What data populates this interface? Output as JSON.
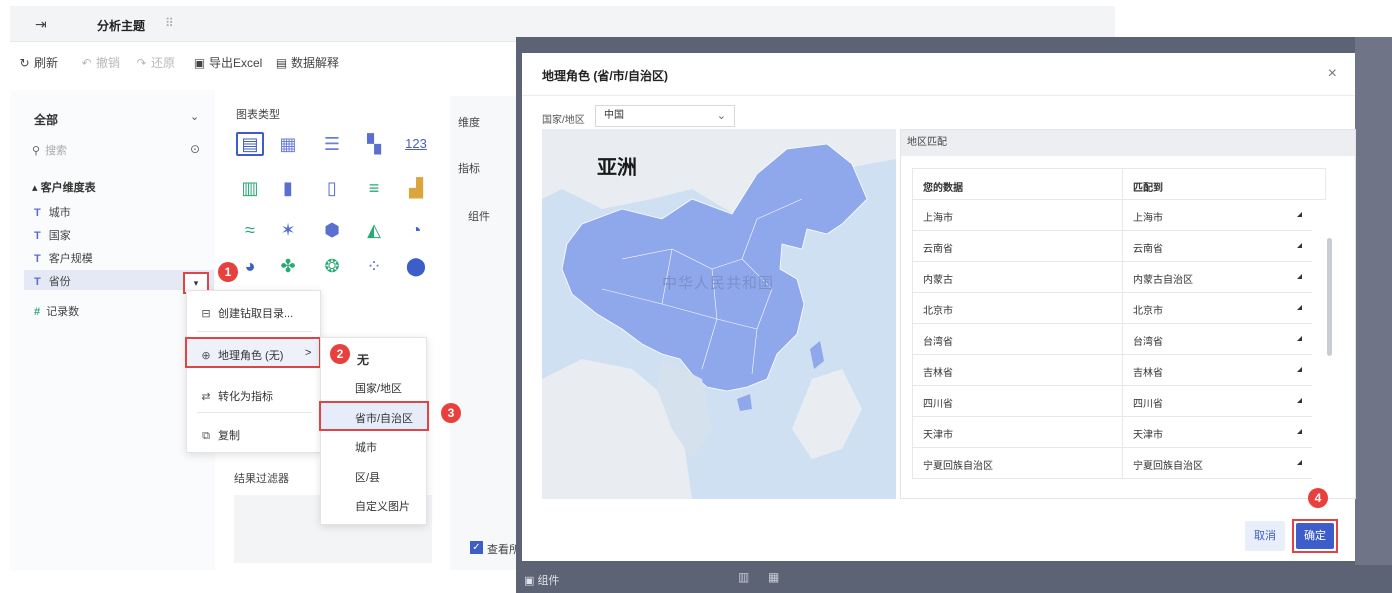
{
  "titlebar": {
    "back_icon": "exit-icon",
    "tab_label": "分析主题",
    "grip": "⠿"
  },
  "toolbar": {
    "refresh": "刷新",
    "undo": "撤销",
    "redo": "还原",
    "export_excel": "导出Excel",
    "data_explain": "数据解释"
  },
  "left": {
    "dropdown_label": "全部",
    "search_placeholder": "搜索",
    "table_name": "客户维度表",
    "fields": [
      "城市",
      "国家",
      "客户规模",
      "省份"
    ],
    "measure_field": "记录数"
  },
  "chart_panel": {
    "title": "图表类型",
    "number_icon_text": "123",
    "result_filter": "结果过滤器"
  },
  "dim_panel": {
    "dimension": "维度",
    "indicator": "指标",
    "component": "组件",
    "check_label": "查看所"
  },
  "context_menu": {
    "items": [
      "创建钻取目录...",
      "地理角色 (无)",
      "转化为指标",
      "复制"
    ],
    "chevron": ">"
  },
  "submenu": {
    "items": [
      "无",
      "国家/地区",
      "省市/自治区",
      "城市",
      "区/县",
      "自定义图片"
    ]
  },
  "markers": [
    "1",
    "2",
    "3",
    "4"
  ],
  "bottom_bar": {
    "label": "组件"
  },
  "modal": {
    "title": "地理角色 (省/市/自治区)",
    "close": "×",
    "country_label": "国家/地区",
    "country_value": "中国",
    "map_continent_label": "亚洲",
    "map_country_label": "中华人民共和国",
    "region_header": "地区匹配",
    "col_your_data": "您的数据",
    "col_match_to": "匹配到",
    "rows": [
      {
        "data": "上海市",
        "match": "上海市"
      },
      {
        "data": "云南省",
        "match": "云南省"
      },
      {
        "data": "内蒙古",
        "match": "内蒙古自治区"
      },
      {
        "data": "北京市",
        "match": "北京市"
      },
      {
        "data": "台湾省",
        "match": "台湾省"
      },
      {
        "data": "吉林省",
        "match": "吉林省"
      },
      {
        "data": "四川省",
        "match": "四川省"
      },
      {
        "data": "天津市",
        "match": "天津市"
      },
      {
        "data": "宁夏回族自治区",
        "match": "宁夏回族自治区"
      }
    ],
    "cancel": "取消",
    "ok": "确定"
  },
  "colors": {
    "accent": "#3d5ec9",
    "highlight_red": "#e04545",
    "map_land": "#8fa8eb",
    "map_water": "#cfe0f2"
  }
}
